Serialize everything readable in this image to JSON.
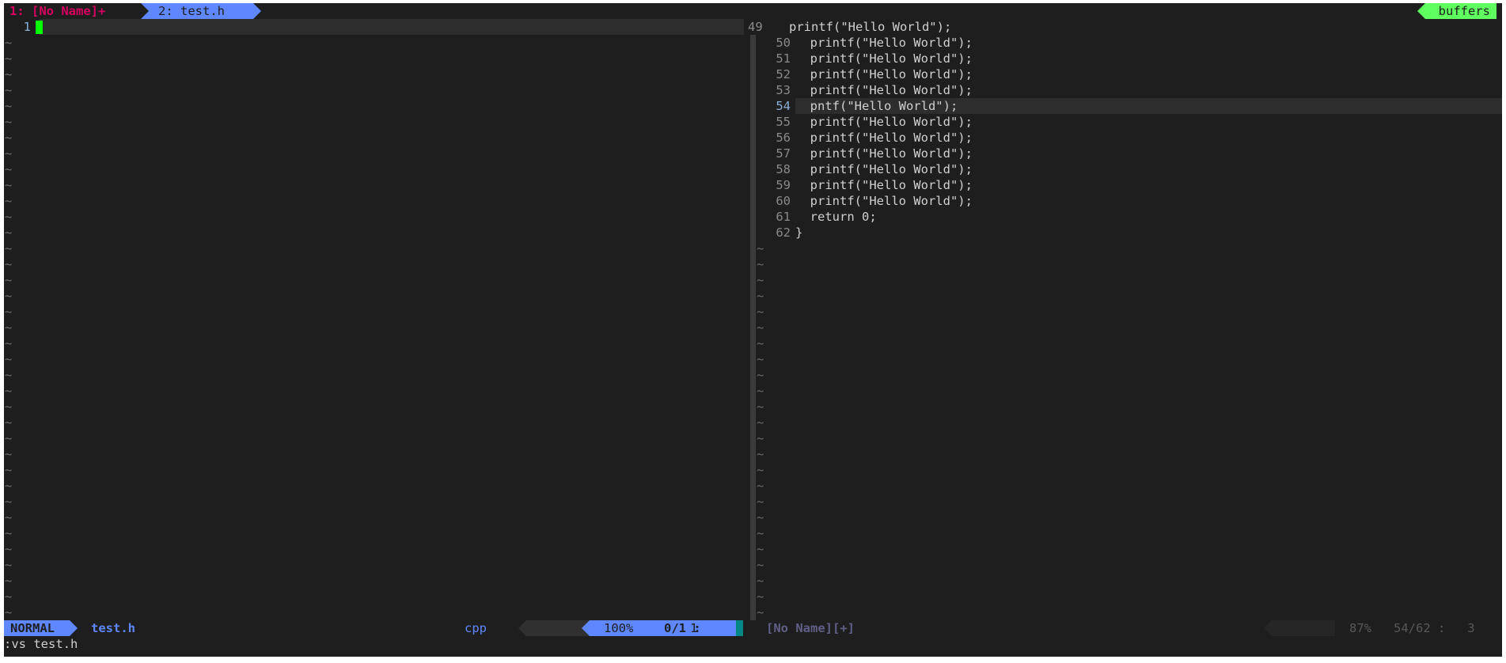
{
  "tabline": {
    "tab1_label": "1: [No Name]+",
    "tab2_label": "2: test.h",
    "buffers_label": "buffers"
  },
  "left_pane": {
    "line_number": "1",
    "tilde": "~"
  },
  "right_pane": {
    "lines": [
      {
        "num": "49",
        "code": "printf(\"Hello World\");"
      },
      {
        "num": "50",
        "code": "  printf(\"Hello World\");"
      },
      {
        "num": "51",
        "code": "  printf(\"Hello World\");"
      },
      {
        "num": "52",
        "code": "  printf(\"Hello World\");"
      },
      {
        "num": "53",
        "code": "  printf(\"Hello World\");"
      },
      {
        "num": "54",
        "code": "  pntf(\"Hello World\");"
      },
      {
        "num": "55",
        "code": "  printf(\"Hello World\");"
      },
      {
        "num": "56",
        "code": "  printf(\"Hello World\");"
      },
      {
        "num": "57",
        "code": "  printf(\"Hello World\");"
      },
      {
        "num": "58",
        "code": "  printf(\"Hello World\");"
      },
      {
        "num": "59",
        "code": "  printf(\"Hello World\");"
      },
      {
        "num": "60",
        "code": "  printf(\"Hello World\");"
      },
      {
        "num": "61",
        "code": "  return 0;"
      },
      {
        "num": "62",
        "code": "}"
      }
    ],
    "current_line": "54"
  },
  "statusline": {
    "mode": "NORMAL",
    "filename": "test.h",
    "filetype": "cpp",
    "percent": "100%",
    "position": "0/1 :",
    "column": "1",
    "right_name": "[No Name][+]",
    "right_position": "87%   54/62 :   3"
  },
  "cmdline": ":vs test.h",
  "colors": {
    "background": "#1e1e1e",
    "accent_blue": "#5f87ff",
    "tab_green": "#5fff5f",
    "cursor_green": "#00ff00",
    "tab_magenta": "#d7005f"
  }
}
